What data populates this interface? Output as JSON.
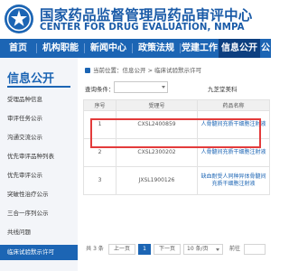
{
  "header": {
    "title_cn": "国家药品监督管理局药品审评中心",
    "title_en": "CENTER FOR DRUG EVALUATION, NMPA"
  },
  "nav": {
    "items": [
      {
        "label": "首页"
      },
      {
        "label": "机构职能"
      },
      {
        "label": "新闻中心"
      },
      {
        "label": "政策法规"
      },
      {
        "label": "党建工作"
      },
      {
        "label": "信息公开"
      },
      {
        "label": "公"
      }
    ],
    "active_index": 5
  },
  "sidebar": {
    "heading": "信息公开",
    "items": [
      {
        "label": "受理品种信息"
      },
      {
        "label": "审评任务公示"
      },
      {
        "label": "沟通交流公示"
      },
      {
        "label": "优先审评品种列表"
      },
      {
        "label": "优先审评公示"
      },
      {
        "label": "突破性治疗公示"
      },
      {
        "label": "三合一序列公示"
      },
      {
        "label": "共线问题"
      },
      {
        "label": "临床试验默示许可"
      }
    ],
    "active_index": 8
  },
  "breadcrumb": {
    "text": "当前位置：信息公开 > 临床试验默示许可"
  },
  "query": {
    "label": "查询条件：",
    "selected": "",
    "value": "九芝堂美科"
  },
  "table": {
    "columns": [
      "序号",
      "受理号",
      "药品名称"
    ],
    "rows": [
      {
        "no": "1",
        "accept_no": "CXSL2400859",
        "drug": "人骨髓间充质干细胞注射液"
      },
      {
        "no": "2",
        "accept_no": "CXSL2300202",
        "drug": "人骨髓间充质干细胞注射液"
      },
      {
        "no": "3",
        "accept_no": "JXSL1900126",
        "drug": "缺血耐受人同种异体骨髓间充质干细胞注射液"
      }
    ]
  },
  "pager": {
    "total": "共 3 条",
    "prev": "上一页",
    "page": "1",
    "next": "下一页",
    "page_size": "10 条/页",
    "goto": "前往"
  },
  "colors": {
    "brand_blue": "#1c65b4",
    "nav_active": "#0d3f80",
    "highlight_red": "#e33b3b"
  }
}
